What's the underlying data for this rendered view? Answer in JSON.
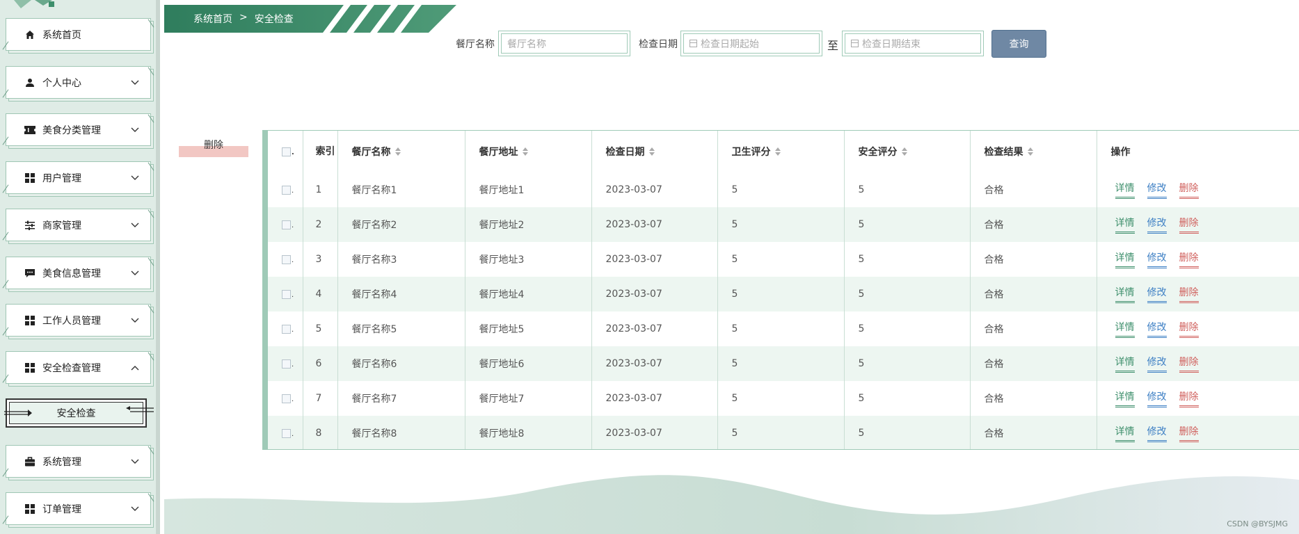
{
  "breadcrumb": {
    "home": "系统首页",
    "separator": ">",
    "current": "安全检查"
  },
  "sidebar": {
    "items": [
      {
        "label": "系统首页",
        "icon": "home-icon",
        "chevron": ""
      },
      {
        "label": "个人中心",
        "icon": "user-icon",
        "chevron": "down"
      },
      {
        "label": "美食分类管理",
        "icon": "ticket-icon",
        "chevron": "down"
      },
      {
        "label": "用户管理",
        "icon": "grid-icon",
        "chevron": "down"
      },
      {
        "label": "商家管理",
        "icon": "sliders-icon",
        "chevron": "down"
      },
      {
        "label": "美食信息管理",
        "icon": "chat-icon",
        "chevron": "down"
      },
      {
        "label": "工作人员管理",
        "icon": "grid-icon",
        "chevron": "down"
      },
      {
        "label": "安全检查管理",
        "icon": "grid-icon",
        "chevron": "up"
      },
      {
        "label": "系统管理",
        "icon": "briefcase-icon",
        "chevron": "down"
      },
      {
        "label": "订单管理",
        "icon": "grid-icon",
        "chevron": "down"
      }
    ],
    "subitem": "安全检查"
  },
  "search": {
    "name_label": "餐厅名称",
    "name_placeholder": "餐厅名称",
    "date_label": "检查日期",
    "date_start_placeholder": "检查日期起始",
    "to_label": "至",
    "date_end_placeholder": "检查日期结束",
    "query_button": "查询"
  },
  "actions": {
    "delete_button": "删除"
  },
  "table": {
    "headers": {
      "index": "索引",
      "name": "餐厅名称",
      "address": "餐厅地址",
      "date": "检查日期",
      "hygiene": "卫生评分",
      "safety": "安全评分",
      "result": "检查结果",
      "ops": "操作"
    },
    "rows": [
      {
        "index": "1",
        "name": "餐厅名称1",
        "address": "餐厅地址1",
        "date": "2023-03-07",
        "hygiene": "5",
        "safety": "5",
        "result": "合格"
      },
      {
        "index": "2",
        "name": "餐厅名称2",
        "address": "餐厅地址2",
        "date": "2023-03-07",
        "hygiene": "5",
        "safety": "5",
        "result": "合格"
      },
      {
        "index": "3",
        "name": "餐厅名称3",
        "address": "餐厅地址3",
        "date": "2023-03-07",
        "hygiene": "5",
        "safety": "5",
        "result": "合格"
      },
      {
        "index": "4",
        "name": "餐厅名称4",
        "address": "餐厅地址4",
        "date": "2023-03-07",
        "hygiene": "5",
        "safety": "5",
        "result": "合格"
      },
      {
        "index": "5",
        "name": "餐厅名称5",
        "address": "餐厅地址5",
        "date": "2023-03-07",
        "hygiene": "5",
        "safety": "5",
        "result": "合格"
      },
      {
        "index": "6",
        "name": "餐厅名称6",
        "address": "餐厅地址6",
        "date": "2023-03-07",
        "hygiene": "5",
        "safety": "5",
        "result": "合格"
      },
      {
        "index": "7",
        "name": "餐厅名称7",
        "address": "餐厅地址7",
        "date": "2023-03-07",
        "hygiene": "5",
        "safety": "5",
        "result": "合格"
      },
      {
        "index": "8",
        "name": "餐厅名称8",
        "address": "餐厅地址8",
        "date": "2023-03-07",
        "hygiene": "5",
        "safety": "5",
        "result": "合格"
      }
    ],
    "op_labels": {
      "detail": "详情",
      "edit": "修改",
      "delete": "删除"
    }
  },
  "watermark": "CSDN @BYSJMG",
  "colors": {
    "accent_green": "#3e8f6c",
    "link_blue": "#3d7fc4",
    "danger_red": "#d0605d",
    "query_button": "#6f88a4"
  }
}
